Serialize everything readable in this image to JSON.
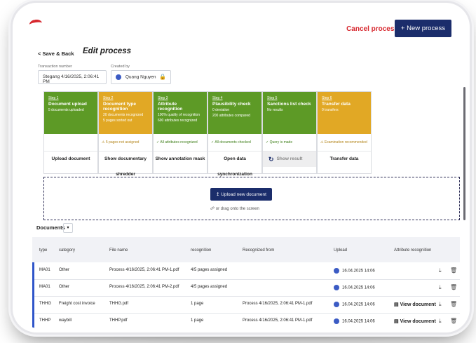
{
  "header": {
    "cancel_label": "Cancel process",
    "new_label": "+ New process"
  },
  "nav": {
    "back_label": "< Save & Back",
    "title": "Edit process"
  },
  "transaction": {
    "label": "Transaction number",
    "value": "Stegang 4/16/2025, 2:06:41 PM"
  },
  "created_by": {
    "label": "Created by",
    "value": "Quang Nguyen"
  },
  "steps": [
    {
      "step": "Step 1",
      "name": "Document upload",
      "sub": "5 documents uploaded",
      "sub2": "",
      "status": "",
      "action": "Upload document",
      "color": "green"
    },
    {
      "step": "Step 2",
      "name": "Document type recognition",
      "sub": "20 documents recognized",
      "sub2": "5 pages sorted out",
      "status": "5 pages not assigned",
      "action": "Show documentary shredder",
      "color": "yellow"
    },
    {
      "step": "Step 3",
      "name": "Attribute recognition",
      "sub": "100% quality of recognition",
      "sub2": "690 attributes recognized",
      "status": "All attributes recognized",
      "action": "Show annotation mask",
      "color": "green"
    },
    {
      "step": "Step 4",
      "name": "Plausibility check",
      "sub": "0 deviation",
      "sub2": "200 attributes compared",
      "status": "All documents checked",
      "action": "Open data synchronization",
      "color": "green"
    },
    {
      "step": "Step 5",
      "name": "Sanctions list check",
      "sub": "No results",
      "sub2": "",
      "status": "Query is made",
      "action": "Show result",
      "color": "green"
    },
    {
      "step": "Step 6",
      "name": "Transfer data",
      "sub": "0 transfers",
      "sub2": "",
      "status": "Examination recommended",
      "action": "Transfer data",
      "color": "yellow"
    }
  ],
  "upload": {
    "button": "Upload new document",
    "drop_text": "or drag onto the screen"
  },
  "documents": {
    "label": "Documents",
    "columns": [
      "type",
      "category",
      "File name",
      "recognition",
      "Recognized from",
      "Upload",
      "Attribute recognition"
    ],
    "rows": [
      {
        "type": "MA01",
        "category": "Other",
        "file": "Process 4/16/2025, 2:06:41 PM-1.pdf",
        "recognition": "4/5 pages assigned",
        "from": "",
        "upload": "16.04.2025 14:06",
        "attr": ""
      },
      {
        "type": "MA01",
        "category": "Other",
        "file": "Process 4/16/2025, 2:06:41 PM-2.pdf",
        "recognition": "4/5 pages assigned",
        "from": "",
        "upload": "16.04.2025 14:06",
        "attr": ""
      },
      {
        "type": "THHG",
        "category": "Freight cost invoice",
        "file": "THHG.pdf",
        "recognition": "1 page",
        "from": "Process 4/16/2025, 2:06:41 PM-1.pdf",
        "upload": "16.04.2025 14:06",
        "attr": "View document"
      },
      {
        "type": "THHP",
        "category": "waybill",
        "file": "THHP.pdf",
        "recognition": "1 page",
        "from": "Process 4/16/2025, 2:06:41 PM-1.pdf",
        "upload": "16.04.2025 14:06",
        "attr": "View document"
      }
    ]
  },
  "colors": {
    "brand_navy": "#1b2d6b",
    "cancel_red": "#d7282f",
    "step_green": "#5d9a26",
    "step_yellow": "#e1a825"
  }
}
